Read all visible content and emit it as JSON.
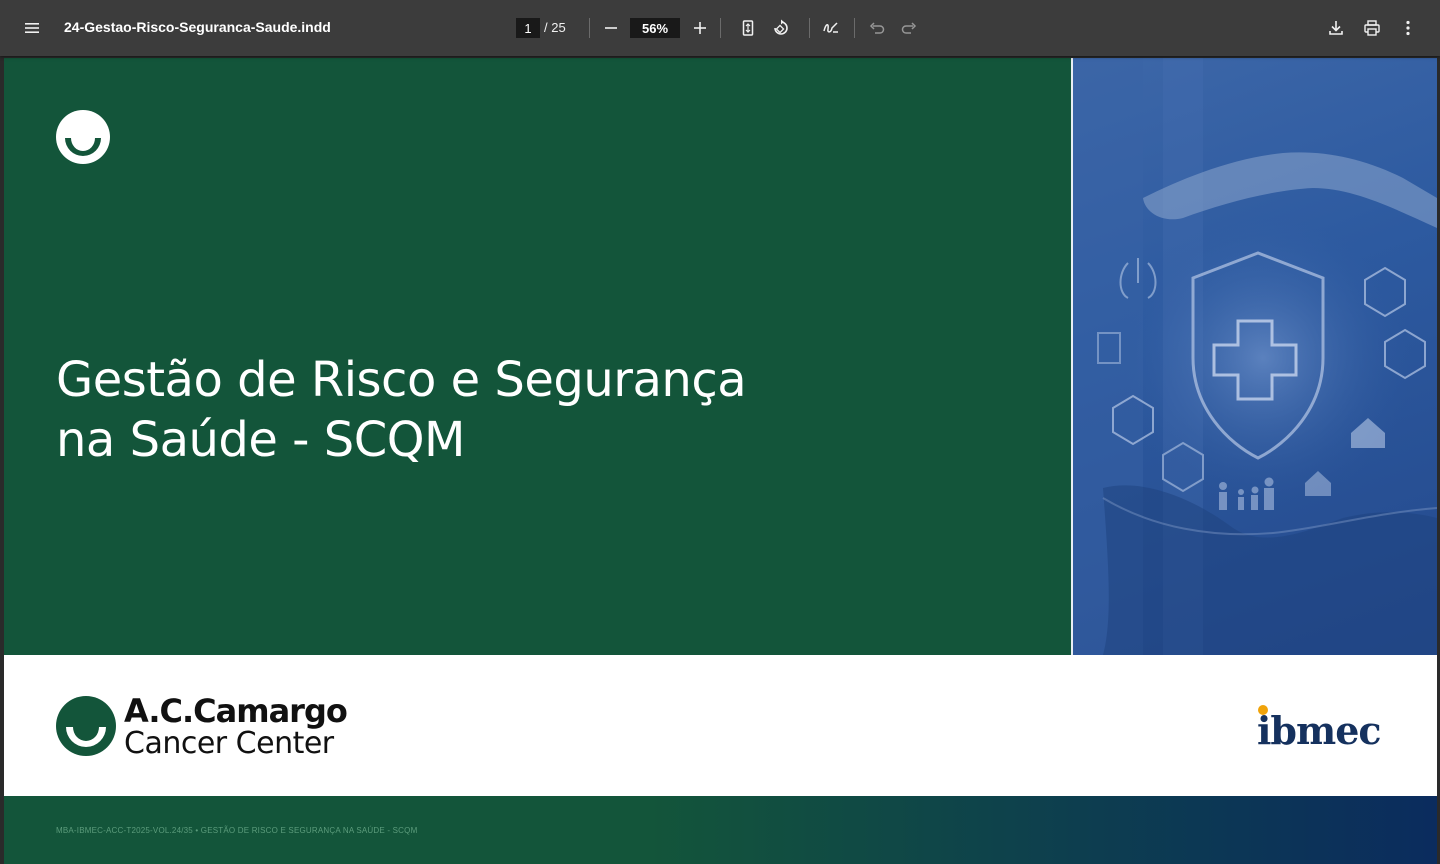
{
  "toolbar": {
    "menu_icon": "hamburger-menu-icon",
    "file_title": "24-Gestao-Risco-Seguranca-Saude.indd",
    "page_current": "1",
    "page_total": "/ 25",
    "zoom_value": "56%",
    "icons": [
      "zoom-out-icon",
      "zoom-in-icon",
      "fit-page-icon",
      "rotate-icon",
      "annotate-icon",
      "undo-icon",
      "redo-icon",
      "download-icon",
      "print-icon",
      "more-options-icon"
    ]
  },
  "document": {
    "heading_line1": "Gestão de Risco e Segurança",
    "heading_line2": "na Saúde - SCQM",
    "brand_line1": "A.C.Camargo",
    "brand_line2": "Cancer Center",
    "partner_logo": "ibmec",
    "footer_text": "MBA-IBMEC-ACC-T2025-VOL.24/35 • GESTÃO DE RISCO E SEGURANÇA NA SAÚDE - SCQM",
    "colors": {
      "green": "#13553a",
      "blue": "#2d5aa0",
      "navy": "#15315e",
      "accent": "#f0a30a"
    }
  }
}
